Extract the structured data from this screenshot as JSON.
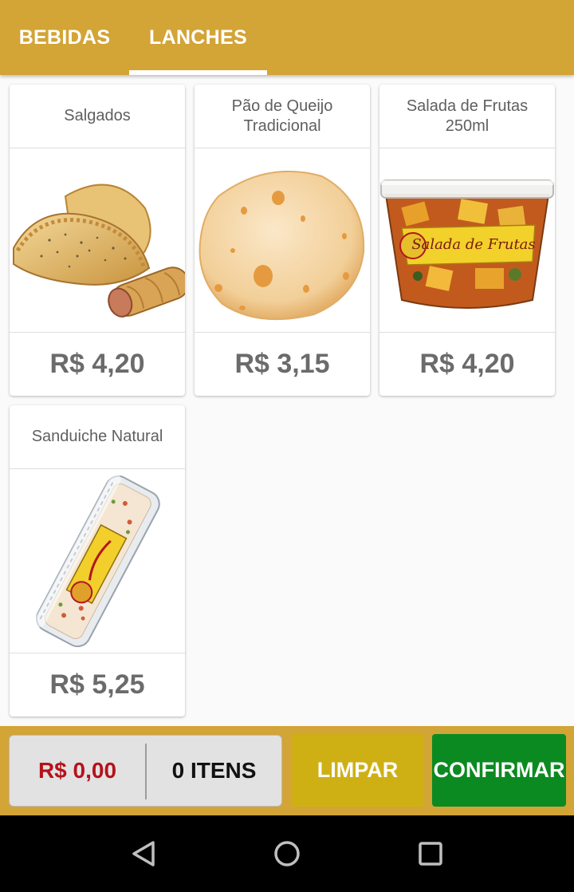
{
  "tabs": [
    {
      "label": "BEBIDAS"
    },
    {
      "label": "LANCHES"
    }
  ],
  "products": [
    {
      "name": "Salgados",
      "price": "R$ 4,20",
      "image_icon": "pastry-image"
    },
    {
      "name": "Pão de Queijo Tradicional",
      "price": "R$ 3,15",
      "image_icon": "cheese-bread-image"
    },
    {
      "name": "Salada de Frutas 250ml",
      "price": "R$ 4,20",
      "image_icon": "fruit-salad-cup-image"
    },
    {
      "name": "Sanduiche Natural",
      "price": "R$ 5,25",
      "image_icon": "wrapped-sandwich-image"
    }
  ],
  "footer": {
    "total": "R$ 0,00",
    "item_count": "0 ITENS",
    "clear_label": "LIMPAR",
    "confirm_label": "CONFIRMAR"
  },
  "colors": {
    "accent": "#d3a436",
    "total_text": "#b5121b",
    "clear_button": "#cfb014",
    "confirm_button": "#0c8a22"
  },
  "system_nav": [
    "back-icon",
    "home-icon",
    "recent-apps-icon"
  ]
}
